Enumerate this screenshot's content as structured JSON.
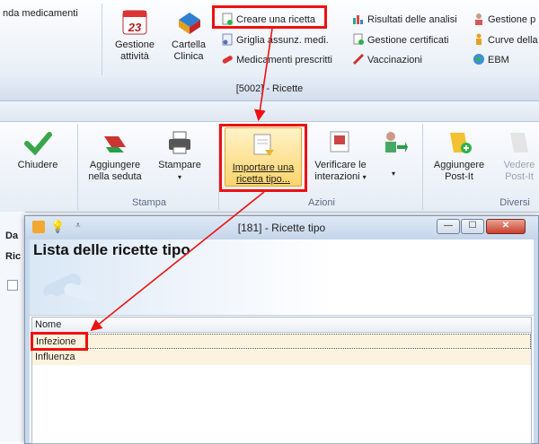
{
  "ribbon_top": {
    "cut_label": "nda medicamenti",
    "gestione_attivita": "Gestione attività",
    "cartella_clinica": "Cartella Clinica",
    "creare_ricetta": "Creare una ricetta",
    "griglia": "Griglia assunz. medi.",
    "medicamenti_prescritti": "Medicamenti prescritti",
    "risultati_analisi": "Risultati delle analisi",
    "gestione_certificati": "Gestione certificati",
    "vaccinazioni": "Vaccinazioni",
    "gestione_p": "Gestione p",
    "curve": "Curve della",
    "ebm": "EBM",
    "calendar_number": "23"
  },
  "window_title": "[5002] - Ricette",
  "ribbon2": {
    "chiudere": "Chiudere",
    "aggiungere_seduta": "Aggiungere nella seduta",
    "stampare": "Stampare",
    "importare": "Importare una ricetta tipo...",
    "verificare": "Verificare le interazioni",
    "aggiungere_postit": "Aggiungere Post-It",
    "vedere_postit": "Vedere Post-It",
    "group_stampa": "Stampa",
    "group_azioni": "Azioni",
    "group_diversi": "Diversi"
  },
  "side_labels": [
    "Da",
    "Ric"
  ],
  "dialog": {
    "title": "[181] - Ricette tipo",
    "header": "Lista delle ricette tipo",
    "column_header": "Nome",
    "rows": [
      "Infezione",
      "Influenza"
    ]
  },
  "colors": {
    "highlight_red": "#e11111",
    "selected_row": "#fbf3dd",
    "ribbon_blue": "#dfe7f2"
  }
}
